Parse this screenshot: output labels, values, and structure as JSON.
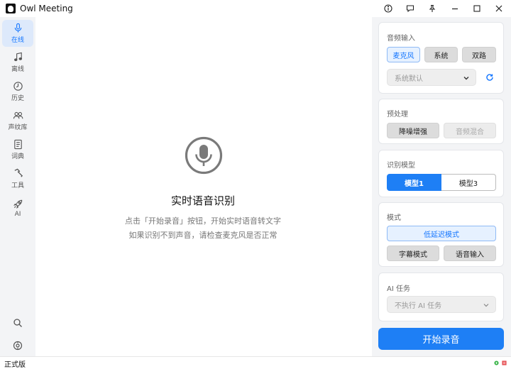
{
  "window": {
    "title": "Owl Meeting",
    "icons": [
      "info-icon",
      "chat-icon",
      "pin-icon",
      "minimize-icon",
      "maximize-icon",
      "close-icon"
    ]
  },
  "sidebar": {
    "items": [
      {
        "label": "在线",
        "icon": "microphone-icon",
        "active": true
      },
      {
        "label": "离线",
        "icon": "music-note-icon"
      },
      {
        "label": "历史",
        "icon": "clock-icon"
      },
      {
        "label": "声纹库",
        "icon": "users-icon"
      },
      {
        "label": "词典",
        "icon": "book-icon"
      },
      {
        "label": "工具",
        "icon": "hammer-icon"
      },
      {
        "label": "AI",
        "icon": "rocket-icon"
      }
    ],
    "bottom_icons": [
      "search-icon",
      "settings-icon"
    ]
  },
  "main": {
    "icon": "microphone-circle-icon",
    "title": "实时语音识别",
    "line1": "点击「开始录音」按钮，开始实时语音转文字",
    "line2": "如果识别不到声音，请检查麦克风是否正常"
  },
  "panel": {
    "audio_input": {
      "title": "音频输入",
      "options": [
        "麦克风",
        "系统",
        "双路"
      ],
      "selected": "麦克风",
      "device": "系统默认"
    },
    "preprocess": {
      "title": "预处理",
      "options": [
        "降噪增强",
        "音频混合"
      ]
    },
    "model": {
      "title": "识别模型",
      "options": [
        "模型1",
        "模型3"
      ],
      "selected": "模型1"
    },
    "mode": {
      "title": "模式",
      "primary": "低延迟模式",
      "options": [
        "字幕模式",
        "语音输入"
      ]
    },
    "ai_task": {
      "title": "AI 任务",
      "value": "不执行 AI 任务"
    },
    "start_label": "开始录音"
  },
  "status": {
    "text": "正式版",
    "accent": "#1e7ff5",
    "ok_color": "#3bb54a",
    "error_color": "#e5484d"
  }
}
